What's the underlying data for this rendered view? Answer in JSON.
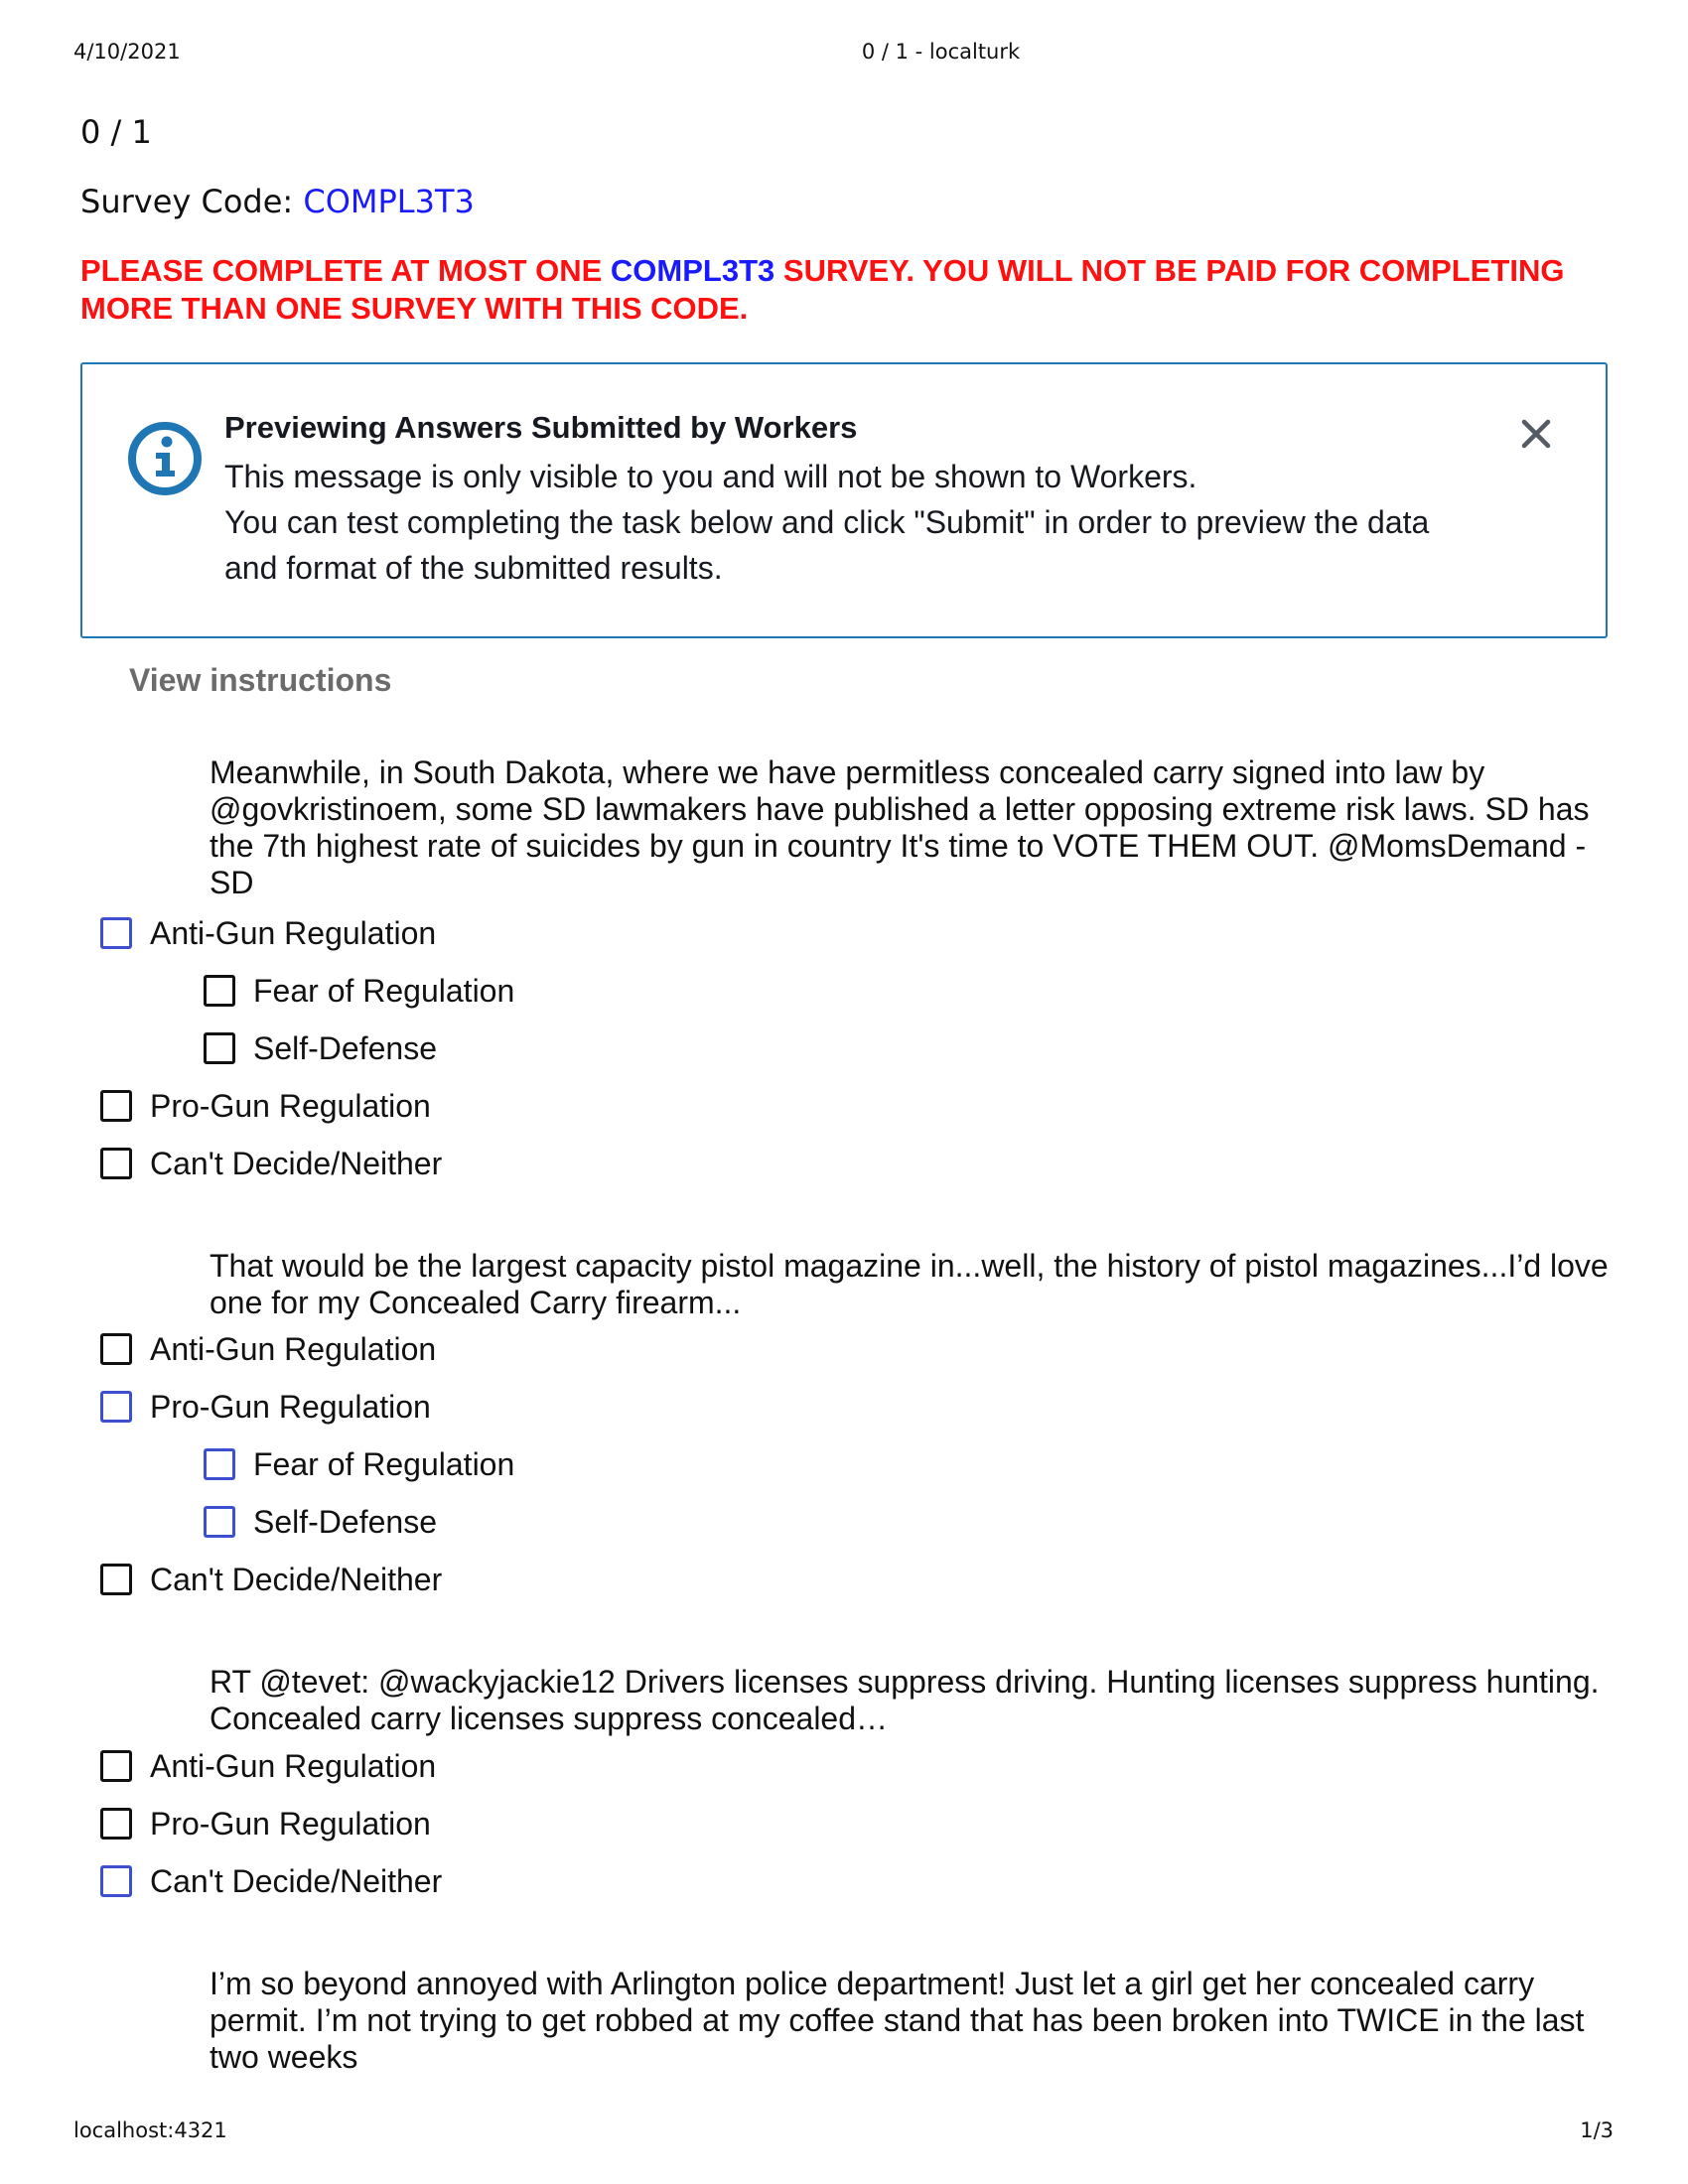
{
  "print_header": {
    "date": "4/10/2021",
    "title": "0 / 1 - localturk"
  },
  "print_footer": {
    "url": "localhost:4321",
    "page": "1/3"
  },
  "progress": "0 / 1",
  "survey_code": {
    "label": "Survey Code: ",
    "code": "COMPL3T3"
  },
  "warning": {
    "part1": "PLEASE COMPLETE AT MOST ONE ",
    "code": "COMPL3T3",
    "part2": " SURVEY. YOU WILL NOT BE PAID FOR COMPLETING MORE THAN ONE SURVEY WITH THIS CODE."
  },
  "preview": {
    "title": "Previewing Answers Submitted by Workers",
    "line1": "This message is only visible to you and will not be shown to Workers.",
    "line2": "You can test completing the task below and click \"Submit\" in order to preview the data",
    "line3": "and format of the submitted results.",
    "accent_color": "#1f76b4"
  },
  "view_instructions": "View instructions",
  "colors": {
    "warning": "#ff1010",
    "code": "#1a1aff",
    "checkbox_default": "#111111",
    "checkbox_focus": "#3d4fd1"
  },
  "tweets": [
    {
      "text": "Meanwhile, in South Dakota, where we have permitless concealed carry signed into law by @govkristinoem, some SD lawmakers have published a letter opposing extreme risk laws. SD has the 7th highest rate of suicides by gun in country It's time to VOTE THEM OUT. @MomsDemand - SD",
      "options": [
        {
          "label": "Anti-Gun Regulation",
          "checked": false
        },
        {
          "label": "Fear of Regulation",
          "checked": false
        },
        {
          "label": "Self-Defense",
          "checked": false
        },
        {
          "label": "Pro-Gun Regulation",
          "checked": false
        },
        {
          "label": "Can't Decide/Neither",
          "checked": false
        }
      ]
    },
    {
      "text": "That would be the largest capacity pistol magazine in...well, the history of pistol magazines...I’d love one for my Concealed Carry firearm...",
      "options": [
        {
          "label": "Anti-Gun Regulation",
          "checked": false
        },
        {
          "label": "Pro-Gun Regulation",
          "checked": false
        },
        {
          "label": "Fear of Regulation",
          "checked": false
        },
        {
          "label": "Self-Defense",
          "checked": false
        },
        {
          "label": "Can't Decide/Neither",
          "checked": false
        }
      ]
    },
    {
      "text": "RT @tevet: @wackyjackie12 Drivers licenses suppress driving. Hunting licenses suppress hunting. Concealed carry licenses suppress concealed…",
      "options": [
        {
          "label": "Anti-Gun Regulation",
          "checked": false
        },
        {
          "label": "Pro-Gun Regulation",
          "checked": false
        },
        {
          "label": "Can't Decide/Neither",
          "checked": false
        }
      ]
    },
    {
      "text": "I’m so beyond annoyed with Arlington police department! Just let a girl get her concealed carry permit. I’m not trying to get robbed at my coffee stand that has been broken into TWICE in the last two weeks",
      "options": []
    }
  ]
}
